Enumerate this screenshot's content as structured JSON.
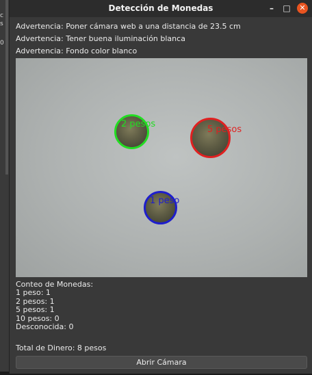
{
  "background_fragments": {
    "a": "c",
    "b": "s",
    "c": "0"
  },
  "window": {
    "title": "Detección de Monedas",
    "controls": {
      "minimize_icon": "minimize-icon",
      "maximize_icon": "maximize-icon",
      "close_icon": "close-icon",
      "close_color": "#e95420"
    }
  },
  "warnings": [
    "Advertencia: Poner cámara web a una distancia de 23.5 cm",
    "Advertencia: Tener buena iluminación blanca",
    "Advertencia: Fondo color blanco"
  ],
  "camera": {
    "coins": [
      {
        "label": "2 pesos",
        "color": "#22dd22"
      },
      {
        "label": "5 pesos",
        "color": "#e02020"
      },
      {
        "label": "1 peso",
        "color": "#1e1ecc"
      }
    ]
  },
  "stats": {
    "heading": "Conteo de Monedas:",
    "lines": [
      "1 peso: 1",
      "2 pesos: 1",
      "5 pesos: 1",
      "10 pesos: 0",
      "Desconocida: 0"
    ],
    "total": "Total de Dinero: 8 pesos"
  },
  "button": {
    "label": "Abrir Cámara"
  }
}
